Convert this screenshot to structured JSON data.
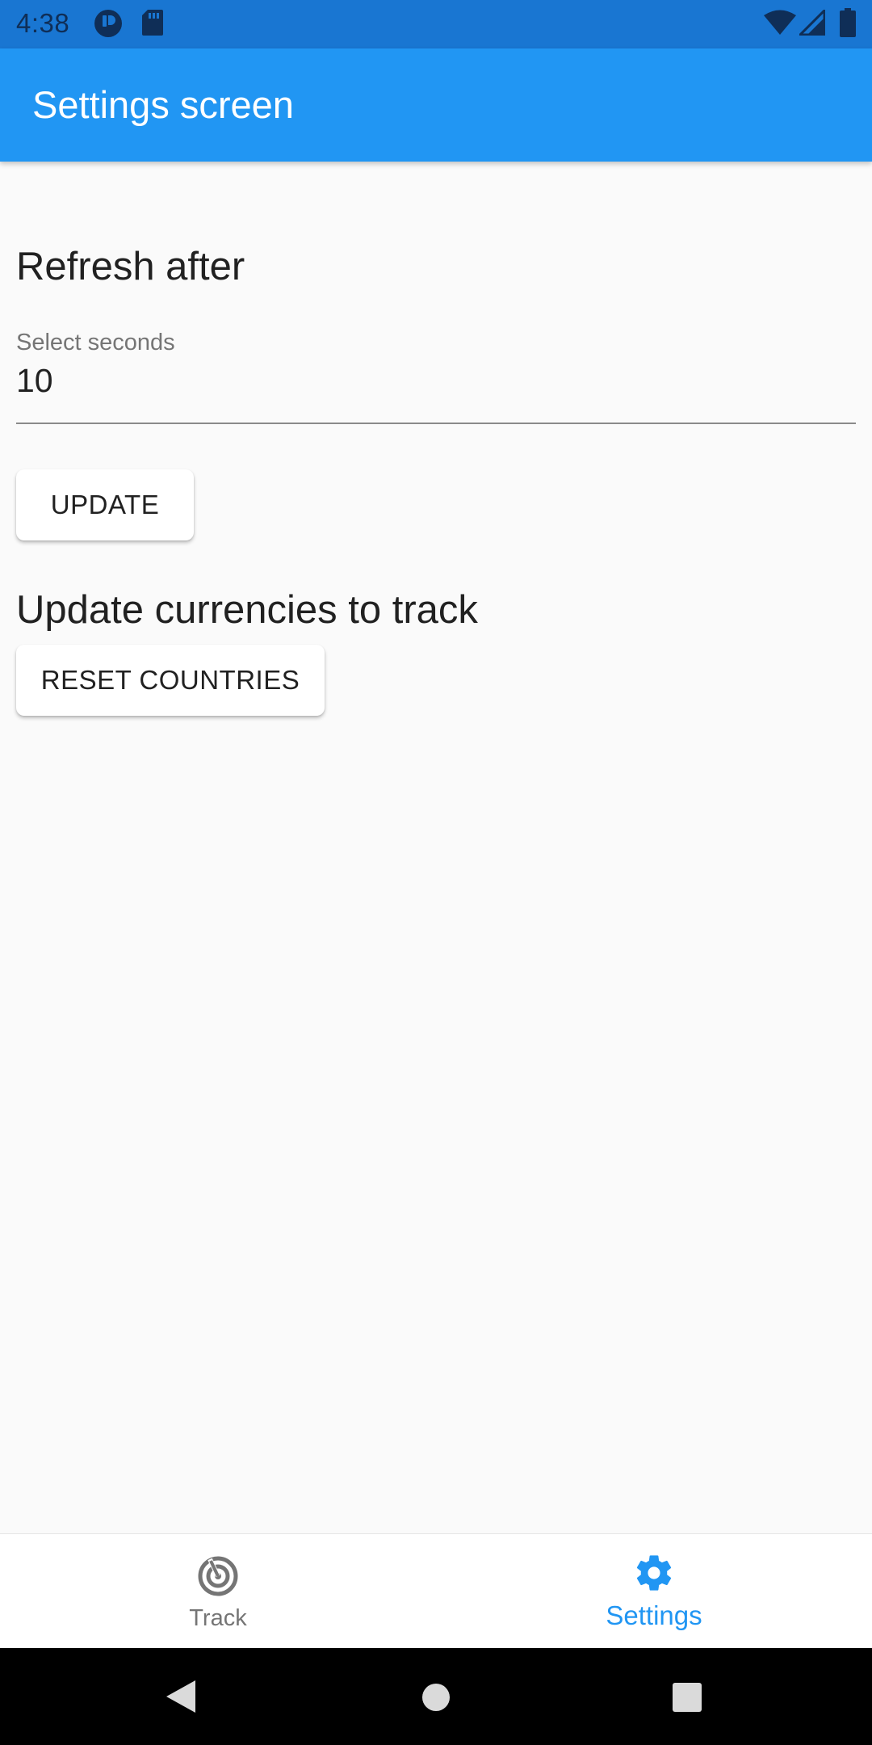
{
  "status_bar": {
    "time": "4:38",
    "icons": [
      "alert-circle-icon",
      "sd-card-icon",
      "wifi-icon",
      "cell-signal-icon",
      "battery-icon"
    ]
  },
  "app_bar": {
    "title": "Settings screen"
  },
  "refresh_section": {
    "heading": "Refresh after",
    "field_label": "Select seconds",
    "field_value": "10",
    "update_button": "UPDATE"
  },
  "currencies_section": {
    "heading": "Update currencies to track",
    "reset_button": "RESET COUNTRIES"
  },
  "bottom_nav": {
    "items": [
      {
        "label": "Track",
        "icon": "radar-icon",
        "active": false
      },
      {
        "label": "Settings",
        "icon": "gear-icon",
        "active": true
      }
    ]
  },
  "colors": {
    "status_bar": "#1976D2",
    "app_bar": "#2196F3",
    "active_nav": "#2196F3",
    "inactive_nav": "#757575",
    "background": "#FAFAFA"
  },
  "system_nav": {
    "icons": [
      "back-icon",
      "home-icon",
      "recents-icon"
    ]
  }
}
